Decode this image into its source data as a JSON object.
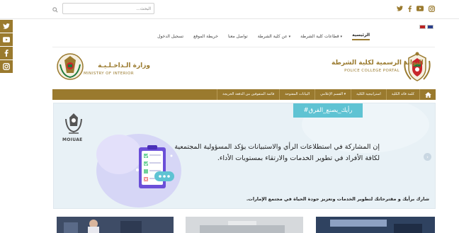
{
  "search": {
    "placeholder": "البحث..."
  },
  "header": {
    "social_icons": [
      "instagram-icon",
      "youtube-icon",
      "facebook-icon",
      "twitter-icon"
    ],
    "language_flags": [
      "uae-flag",
      "uk-flag"
    ]
  },
  "sidebar": {
    "icons": [
      "twitter-icon",
      "youtube-icon",
      "facebook-icon",
      "instagram-icon"
    ]
  },
  "nav": {
    "items": [
      {
        "label": "الرئيسية",
        "active": true
      },
      {
        "label": "قطاعات كلية الشرطة",
        "dropdown": true
      },
      {
        "label": "عن كلية الشرطة",
        "dropdown": true
      },
      {
        "label": "تواصل معنا"
      },
      {
        "label": "خريطة الموقع"
      },
      {
        "label": "تسجيل الدخول"
      }
    ]
  },
  "logos": {
    "college": {
      "arabic": "البوابة الرسمية لكلية الشرطة",
      "english": "POLICE COLLEGE PORTAL"
    },
    "ministry": {
      "arabic": "وزارة الـداخـلـيـة",
      "english": "MINISTRY OF INTERIOR"
    }
  },
  "menubar": {
    "items": [
      "كلمة قائد الكلية",
      "استراتيجية الكلية",
      "القسم الإعلامي",
      "البيانات المفتوحة",
      "قائمة المتفوقين من الدفعة الخريجة"
    ]
  },
  "banner": {
    "hashtag": "#رأيك_يصنع_الفرق",
    "moi_label": "MOIUAE",
    "main_text": "إن المشاركة في استطلاعات الرأي والاستبيانات يؤكد المسؤولية المجتمعية لكافة الأفراد في تطوير الخدمات والارتقاء بمستويات الأداء.",
    "cta_text": "شارك برأيك و مقترحاتك لتطوير الخدمات وتعزيز جودة الحياة في مجتمع الإمارات."
  },
  "colors": {
    "gold": "#9a7a2e",
    "teal": "#5fc3d3",
    "banner_bg": "#e8f1f6",
    "purple": "#6b4fd8"
  }
}
